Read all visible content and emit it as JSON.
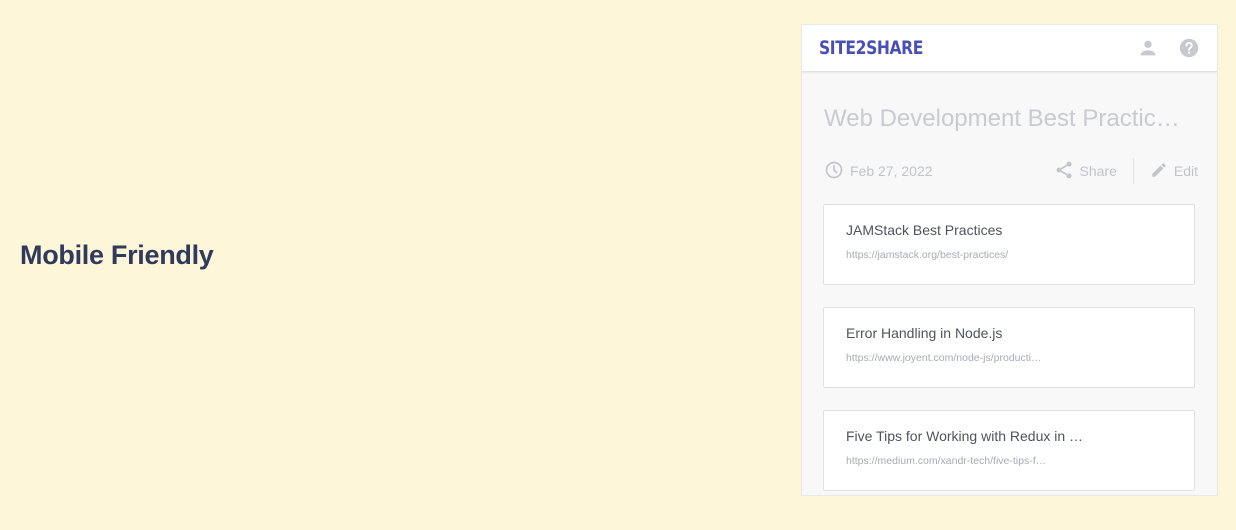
{
  "feature": {
    "title": "Mobile Friendly"
  },
  "app": {
    "logo": "SITE2SHARE",
    "icons": {
      "account": "account-icon",
      "help": "help-icon"
    }
  },
  "collection": {
    "title": "Web Development Best Practic…",
    "date": "Feb 27, 2022",
    "share_label": "Share",
    "edit_label": "Edit"
  },
  "links": [
    {
      "title": "JAMStack Best Practices",
      "url": "https://jamstack.org/best-practices/"
    },
    {
      "title": "Error Handling in Node.js",
      "url": "https://www.joyent.com/node-js/producti…"
    },
    {
      "title": "Five Tips for Working with Redux in …",
      "url": "https://medium.com/xandr-tech/five-tips-f…"
    }
  ],
  "colors": {
    "background": "#fdf6d9",
    "brand": "#4a4fb3",
    "feature_text": "#2f3a5c"
  }
}
